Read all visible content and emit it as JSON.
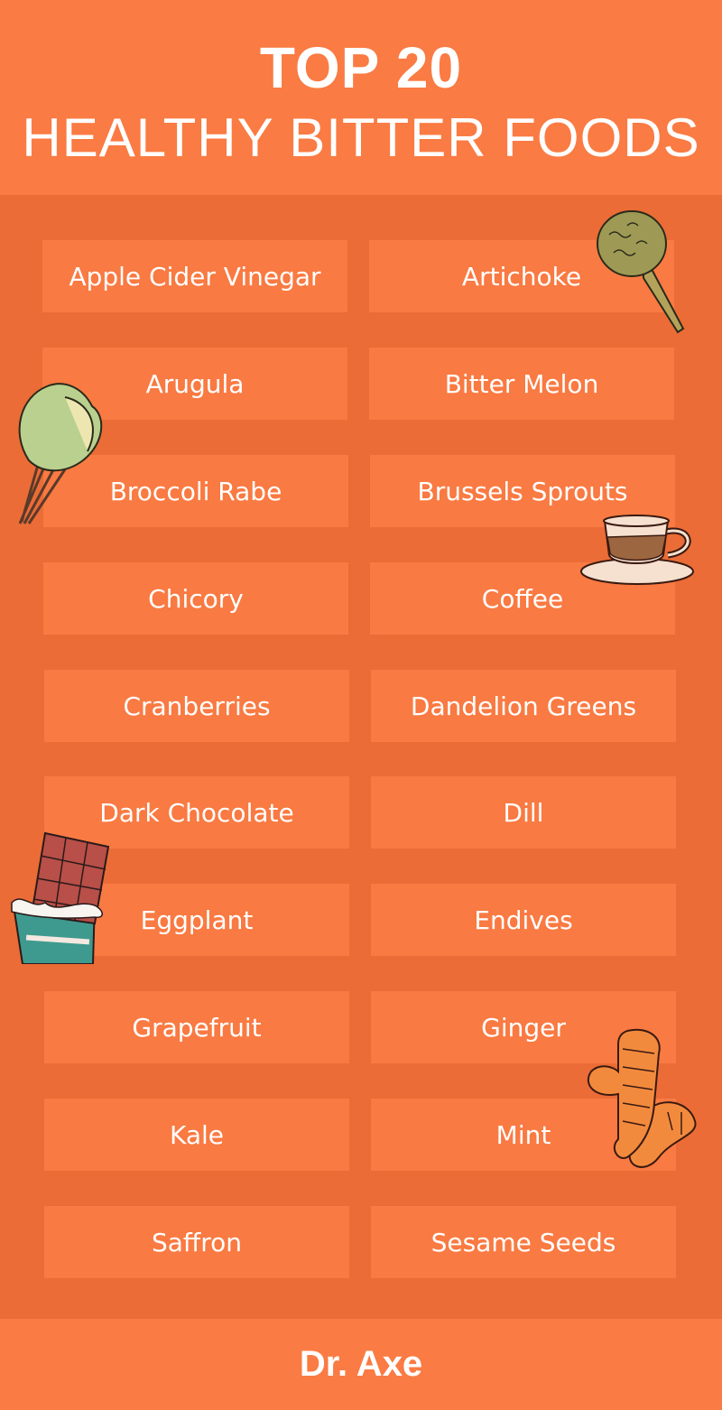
{
  "header": {
    "title_line1": "TOP 20",
    "title_line2": "HEALTHY BITTER FOODS"
  },
  "foods": [
    "Apple Cider Vinegar",
    "Artichoke",
    "Arugula",
    "Bitter Melon",
    "Broccoli Rabe",
    "Brussels Sprouts",
    "Chicory",
    "Coffee",
    "Cranberries",
    "Dandelion Greens",
    "Dark Chocolate",
    "Dill",
    "Eggplant",
    "Endives",
    "Grapefruit",
    "Ginger",
    "Kale",
    "Mint",
    "Saffron",
    "Sesame Seeds"
  ],
  "illustrations": [
    "artichoke-illustration",
    "lettuce-illustration",
    "coffee-cup-illustration",
    "chocolate-bar-illustration",
    "ginger-root-illustration"
  ],
  "footer": {
    "brand": "Dr. Axe"
  },
  "colors": {
    "background": "#EB6C36",
    "tile": "#F97A42",
    "text": "#FFFFFF"
  }
}
